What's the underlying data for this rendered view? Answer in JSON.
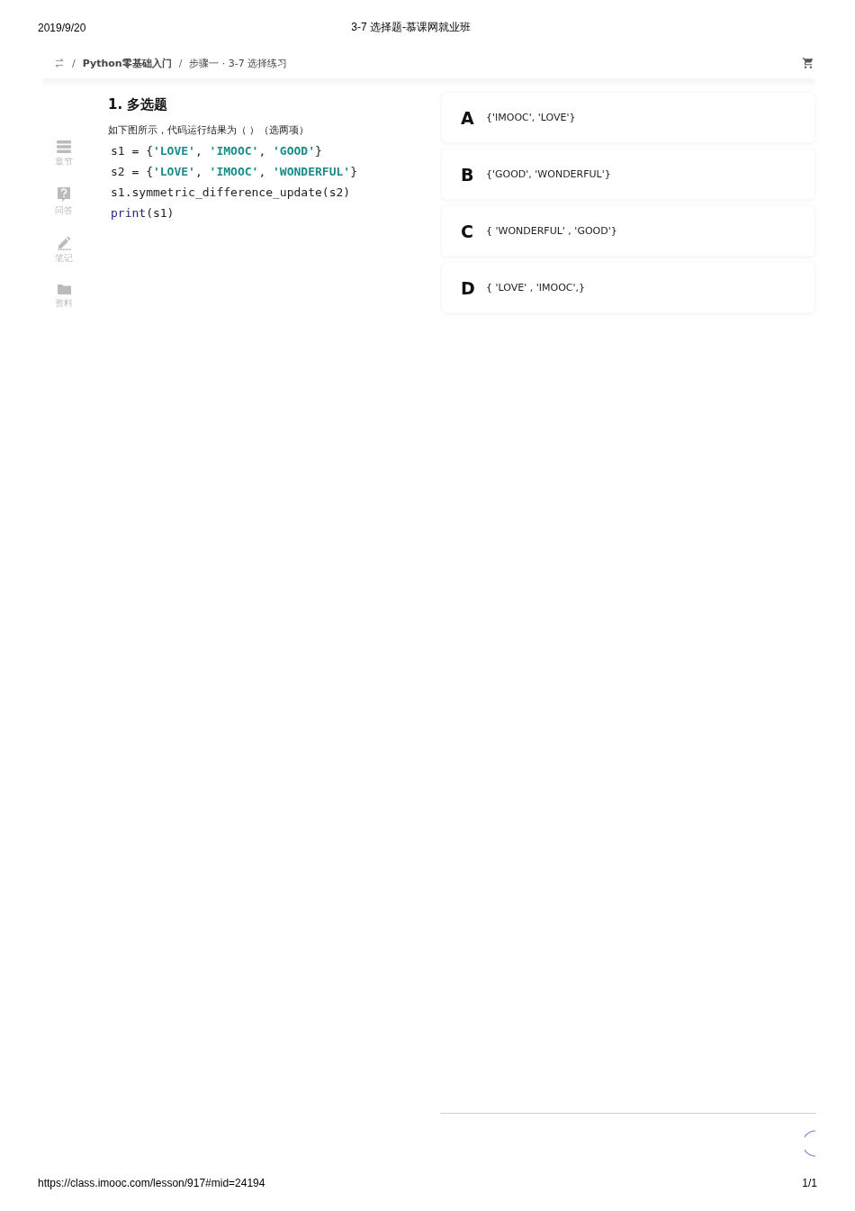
{
  "print_header": {
    "date": "2019/9/20",
    "title": "3-7 选择题-慕课网就业班"
  },
  "breadcrumb": {
    "items": [
      {
        "kind": "separator",
        "text": "/"
      },
      {
        "kind": "link",
        "text": "Python零基础入门"
      },
      {
        "kind": "separator",
        "text": "/"
      },
      {
        "kind": "current",
        "text": "步骤一 · 3-7 选择练习"
      }
    ]
  },
  "sidebar": {
    "items": [
      {
        "kind": "chapters",
        "label": "章节"
      },
      {
        "kind": "qa",
        "label": "问答"
      },
      {
        "kind": "notes",
        "label": "笔记"
      },
      {
        "kind": "files",
        "label": "资料"
      }
    ]
  },
  "question": {
    "title": "1. 多选题",
    "prompt": "如下图所示，代码运行结果为（  ）（选两项）",
    "code_lines": [
      [
        {
          "kind": "plain",
          "text": "s1 = {"
        },
        {
          "kind": "string",
          "text": "'LOVE'"
        },
        {
          "kind": "plain",
          "text": ", "
        },
        {
          "kind": "string",
          "text": "'IMOOC'"
        },
        {
          "kind": "plain",
          "text": ", "
        },
        {
          "kind": "string",
          "text": "'GOOD'"
        },
        {
          "kind": "plain",
          "text": "}"
        }
      ],
      [
        {
          "kind": "plain",
          "text": "s2 = {"
        },
        {
          "kind": "string",
          "text": "'LOVE'"
        },
        {
          "kind": "plain",
          "text": ", "
        },
        {
          "kind": "string",
          "text": "'IMOOC'"
        },
        {
          "kind": "plain",
          "text": ", "
        },
        {
          "kind": "string",
          "text": "'WONDERFUL'"
        },
        {
          "kind": "plain",
          "text": "}"
        }
      ],
      [
        {
          "kind": "plain",
          "text": "s1.symmetric_difference_update(s2)"
        }
      ],
      [
        {
          "kind": "keyword",
          "text": "print"
        },
        {
          "kind": "plain",
          "text": "(s1)"
        }
      ]
    ]
  },
  "options": [
    {
      "letter": "A",
      "text": "{'IMOOC', 'LOVE'}",
      "selected": false
    },
    {
      "letter": "B",
      "text": "{'GOOD', 'WONDERFUL'}",
      "selected": false
    },
    {
      "letter": "C",
      "text": "{ 'WONDERFUL' , 'GOOD'}",
      "selected": false
    },
    {
      "letter": "D",
      "text": "{ 'LOVE' , 'IMOOC',}",
      "selected": false
    }
  ],
  "print_footer": {
    "url": "https://class.imooc.com/lesson/917#mid=24194",
    "page": "1/1"
  }
}
